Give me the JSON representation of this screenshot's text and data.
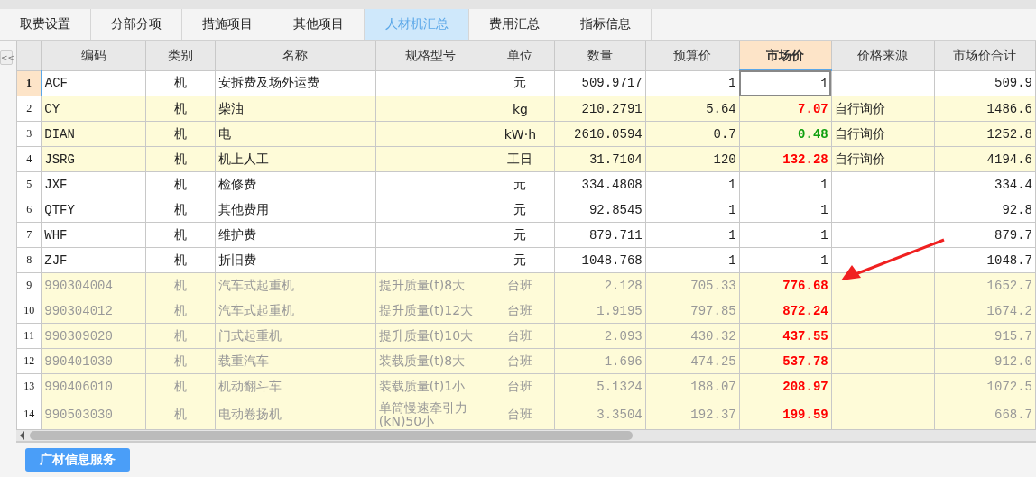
{
  "tabs": [
    {
      "label": "取费设置",
      "selected": false
    },
    {
      "label": "分部分项",
      "selected": false
    },
    {
      "label": "措施项目",
      "selected": false
    },
    {
      "label": "其他项目",
      "selected": false
    },
    {
      "label": "人材机汇总",
      "selected": true
    },
    {
      "label": "费用汇总",
      "selected": false
    },
    {
      "label": "指标信息",
      "selected": false
    }
  ],
  "collapse_button": "<<",
  "table": {
    "columns": [
      {
        "label": "编码",
        "selected": false
      },
      {
        "label": "类别",
        "selected": false
      },
      {
        "label": "名称",
        "selected": false
      },
      {
        "label": "规格型号",
        "selected": false
      },
      {
        "label": "单位",
        "selected": false
      },
      {
        "label": "数量",
        "selected": false
      },
      {
        "label": "预算价",
        "selected": false
      },
      {
        "label": "市场价",
        "selected": true
      },
      {
        "label": "价格来源",
        "selected": false
      },
      {
        "label": "市场价合计",
        "selected": false
      }
    ],
    "rows": [
      {
        "number": "1",
        "selected": true,
        "highlighted": false,
        "dimmed": false,
        "code": "ACF",
        "category": "机",
        "name": "安拆费及场外运费",
        "spec": "",
        "unit": "元",
        "quantity": "509.9717",
        "budget_price": "1",
        "market_price": "1",
        "price_up": false,
        "price_down": false,
        "price_source": "",
        "market_total": "509.9"
      },
      {
        "number": "2",
        "selected": false,
        "highlighted": true,
        "dimmed": false,
        "code": "CY",
        "category": "机",
        "name": "柴油",
        "spec": "",
        "unit": "kg",
        "quantity": "210.2791",
        "budget_price": "5.64",
        "market_price": "7.07",
        "price_up": true,
        "price_down": false,
        "price_source": "自行询价",
        "market_total": "1486.6"
      },
      {
        "number": "3",
        "selected": false,
        "highlighted": true,
        "dimmed": false,
        "code": "DIAN",
        "category": "机",
        "name": "电",
        "spec": "",
        "unit": "kW·h",
        "quantity": "2610.0594",
        "budget_price": "0.7",
        "market_price": "0.48",
        "price_up": false,
        "price_down": true,
        "price_source": "自行询价",
        "market_total": "1252.8"
      },
      {
        "number": "4",
        "selected": false,
        "highlighted": true,
        "dimmed": false,
        "code": "JSRG",
        "category": "机",
        "name": "机上人工",
        "spec": "",
        "unit": "工日",
        "quantity": "31.7104",
        "budget_price": "120",
        "market_price": "132.28",
        "price_up": true,
        "price_down": false,
        "price_source": "自行询价",
        "market_total": "4194.6"
      },
      {
        "number": "5",
        "selected": false,
        "highlighted": false,
        "dimmed": false,
        "code": "JXF",
        "category": "机",
        "name": "检修费",
        "spec": "",
        "unit": "元",
        "quantity": "334.4808",
        "budget_price": "1",
        "market_price": "1",
        "price_up": false,
        "price_down": false,
        "price_source": "",
        "market_total": "334.4"
      },
      {
        "number": "6",
        "selected": false,
        "highlighted": false,
        "dimmed": false,
        "code": "QTFY",
        "category": "机",
        "name": "其他费用",
        "spec": "",
        "unit": "元",
        "quantity": "92.8545",
        "budget_price": "1",
        "market_price": "1",
        "price_up": false,
        "price_down": false,
        "price_source": "",
        "market_total": "92.8"
      },
      {
        "number": "7",
        "selected": false,
        "highlighted": false,
        "dimmed": false,
        "code": "WHF",
        "category": "机",
        "name": "维护费",
        "spec": "",
        "unit": "元",
        "quantity": "879.711",
        "budget_price": "1",
        "market_price": "1",
        "price_up": false,
        "price_down": false,
        "price_source": "",
        "market_total": "879.7"
      },
      {
        "number": "8",
        "selected": false,
        "highlighted": false,
        "dimmed": false,
        "code": "ZJF",
        "category": "机",
        "name": "折旧费",
        "spec": "",
        "unit": "元",
        "quantity": "1048.768",
        "budget_price": "1",
        "market_price": "1",
        "price_up": false,
        "price_down": false,
        "price_source": "",
        "market_total": "1048.7"
      },
      {
        "number": "9",
        "selected": false,
        "highlighted": true,
        "dimmed": true,
        "code": "990304004",
        "category": "机",
        "name": "汽车式起重机",
        "spec": "提升质量(t)8大",
        "unit": "台班",
        "quantity": "2.128",
        "budget_price": "705.33",
        "market_price": "776.68",
        "price_up": true,
        "price_down": false,
        "price_source": "",
        "market_total": "1652.7"
      },
      {
        "number": "10",
        "selected": false,
        "highlighted": true,
        "dimmed": true,
        "code": "990304012",
        "category": "机",
        "name": "汽车式起重机",
        "spec": "提升质量(t)12大",
        "unit": "台班",
        "quantity": "1.9195",
        "budget_price": "797.85",
        "market_price": "872.24",
        "price_up": true,
        "price_down": false,
        "price_source": "",
        "market_total": "1674.2"
      },
      {
        "number": "11",
        "selected": false,
        "highlighted": true,
        "dimmed": true,
        "code": "990309020",
        "category": "机",
        "name": "门式起重机",
        "spec": "提升质量(t)10大",
        "unit": "台班",
        "quantity": "2.093",
        "budget_price": "430.32",
        "market_price": "437.55",
        "price_up": true,
        "price_down": false,
        "price_source": "",
        "market_total": "915.7"
      },
      {
        "number": "12",
        "selected": false,
        "highlighted": true,
        "dimmed": true,
        "code": "990401030",
        "category": "机",
        "name": "载重汽车",
        "spec": "装载质量(t)8大",
        "unit": "台班",
        "quantity": "1.696",
        "budget_price": "474.25",
        "market_price": "537.78",
        "price_up": true,
        "price_down": false,
        "price_source": "",
        "market_total": "912.0"
      },
      {
        "number": "13",
        "selected": false,
        "highlighted": true,
        "dimmed": true,
        "code": "990406010",
        "category": "机",
        "name": "机动翻斗车",
        "spec": "装载质量(t)1小",
        "unit": "台班",
        "quantity": "5.1324",
        "budget_price": "188.07",
        "market_price": "208.97",
        "price_up": true,
        "price_down": false,
        "price_source": "",
        "market_total": "1072.5"
      },
      {
        "number": "14",
        "selected": false,
        "highlighted": true,
        "dimmed": true,
        "code": "990503030",
        "category": "机",
        "name": "电动卷扬机",
        "spec": "单筒慢速牵引力(kN)50小",
        "unit": "台班",
        "quantity": "3.3504",
        "budget_price": "192.37",
        "market_price": "199.59",
        "price_up": true,
        "price_down": false,
        "price_source": "",
        "market_total": "668.7"
      }
    ]
  },
  "bottom_button": "广材信息服务"
}
